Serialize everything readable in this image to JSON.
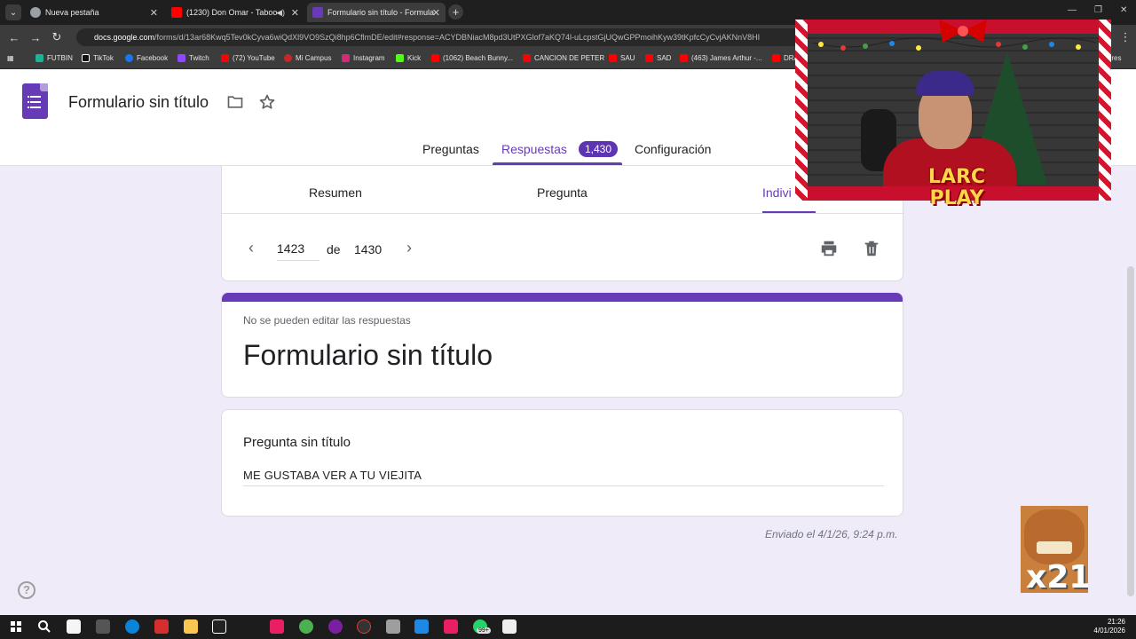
{
  "browser": {
    "tabs": [
      {
        "title": "Nueva pestaña",
        "active": false
      },
      {
        "title": "(1230) Don Omar - Taboo",
        "active": false
      },
      {
        "title": "Formulario sin título - Formula",
        "active": true
      }
    ],
    "url_host": "docs.google.com",
    "url_path": "/forms/d/13ar68Kwq5Tev0kCyva6wiQdXl9VO9SzQi8hp6CflmDE/edit#response=ACYDBNiacM8pd3UtPXGlof7aKQ74l-uLcpstGjUQwGPPmoihKyw39tKpfcCyCvjAKNnV8HI",
    "bookmarks": [
      "FUTBIN",
      "TikTok",
      "Facebook",
      "Twitch",
      "(72) YouTube",
      "Mi Campus",
      "Instagram",
      "Kick",
      "(1062) Beach Bunny...",
      "CANCION DE PETER",
      "SAU",
      "SAD",
      "(463) James Arthur -...",
      "DRA",
      "adores"
    ]
  },
  "forms": {
    "title": "Formulario sin título",
    "tabs": {
      "preguntas": "Preguntas",
      "respuestas": "Respuestas",
      "configuracion": "Configuración"
    },
    "responses_count": "1,430",
    "subtabs": {
      "resumen": "Resumen",
      "pregunta": "Pregunta",
      "individual": "Indivi"
    },
    "pager": {
      "current": "1423",
      "of": "de",
      "total": "1430"
    },
    "notice": "No se pueden editar las respuestas",
    "form_title": "Formulario sin título",
    "question_title": "Pregunta sin título",
    "answer": "ME GUSTABA VER A TU VIEJITA",
    "submitted": "Enviado el 4/1/26, 9:24 p.m."
  },
  "overlay": {
    "logo_line1": "LARC",
    "logo_line2": "PLAY",
    "meme_text": "x21"
  },
  "taskbar": {
    "time": "21:26",
    "date": "4/01/2026",
    "badge": "99+"
  },
  "colors": {
    "accent": "#673ab7",
    "background": "#f0ebf8"
  }
}
